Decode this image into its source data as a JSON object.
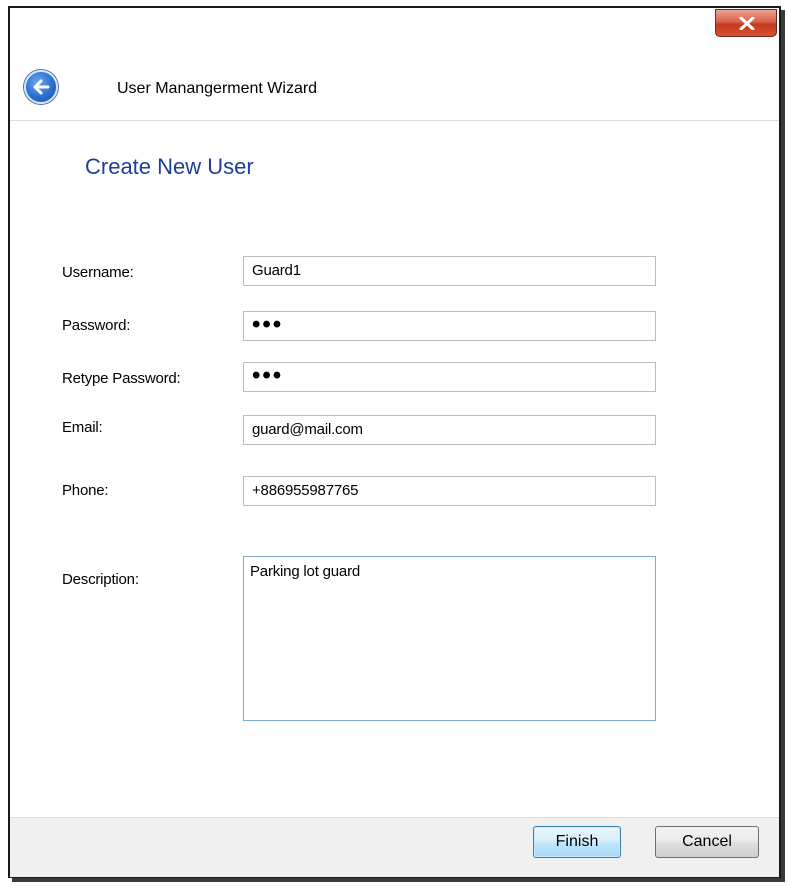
{
  "window": {
    "title": "User Manangerment Wizard",
    "close_glyph": "x"
  },
  "page": {
    "heading": "Create New User"
  },
  "form": {
    "username": {
      "label": "Username:",
      "value": "Guard1"
    },
    "password": {
      "label": "Password:",
      "value": "•••"
    },
    "retype_password": {
      "label": "Retype Password:",
      "value": "•••"
    },
    "email": {
      "label": "Email:",
      "value": "guard@mail.com"
    },
    "phone": {
      "label": "Phone:",
      "value": "+886955987765"
    },
    "description": {
      "label": "Description:",
      "value": "Parking lot guard"
    }
  },
  "buttons": {
    "finish": "Finish",
    "cancel": "Cancel"
  },
  "icons": {
    "back": "back-arrow-icon",
    "close": "close-icon"
  },
  "colors": {
    "heading": "#1e3f9a",
    "close_button": "#c2391f",
    "finish_border": "#3c7fb1"
  }
}
